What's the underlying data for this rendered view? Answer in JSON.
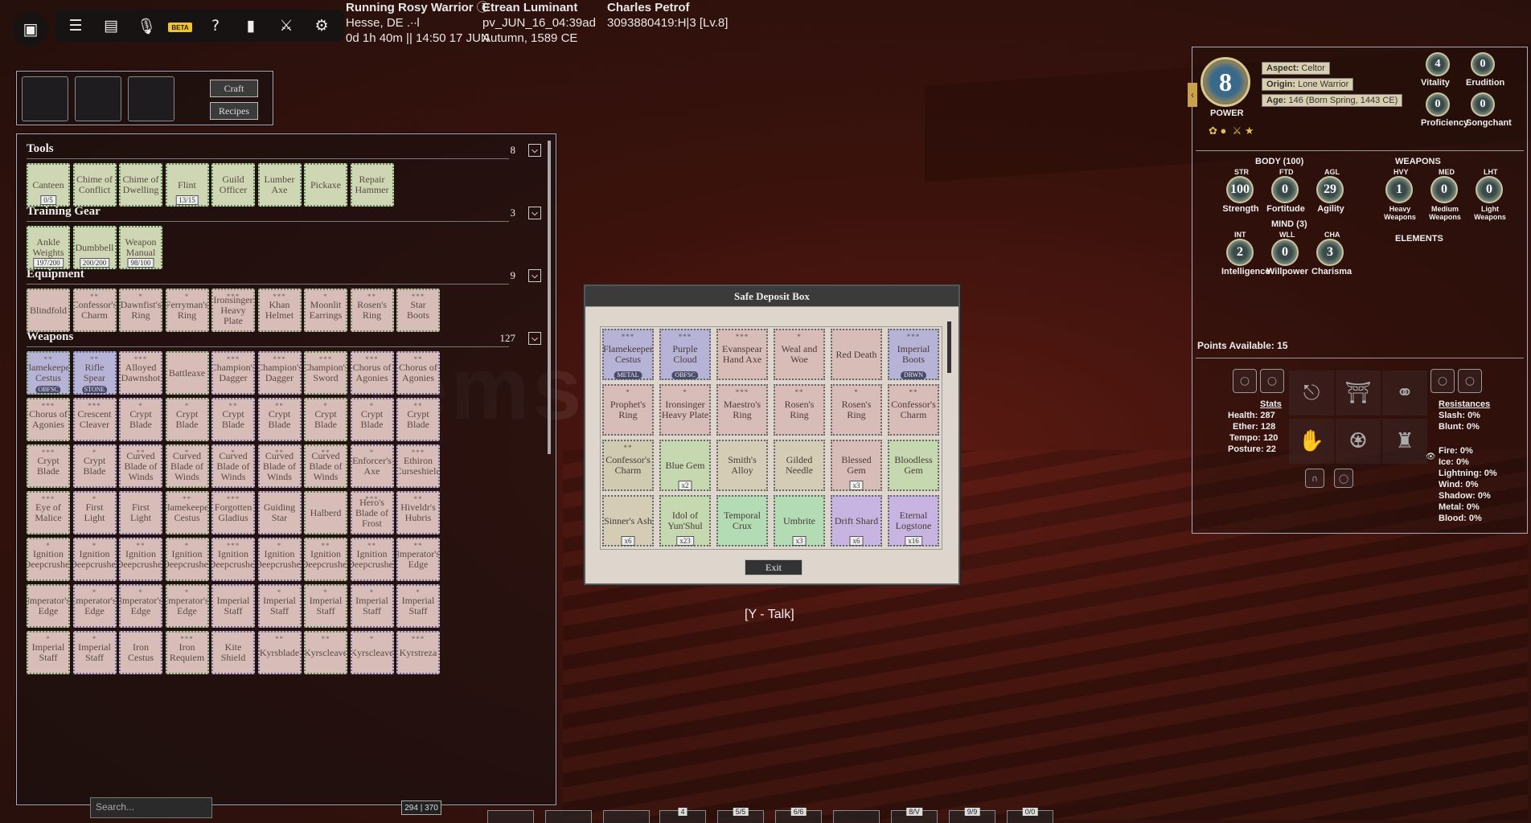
{
  "topbar": {
    "beta": "BETA",
    "server": {
      "name": "Running Rosy Warrior",
      "region": "Hesse, DE .∙∙l",
      "uptime": "0d 1h 40m || 14:50 17 JUN"
    },
    "realm": {
      "name": "Etrean Luminant",
      "id": "pv_JUN_16_04:39ad",
      "date": "Autumn, 1589 CE"
    },
    "player": {
      "name": "Charles Petrof",
      "id": "3093880419:H|3 [Lv.8]"
    }
  },
  "craft": {
    "craft_label": "Craft",
    "recipes_label": "Recipes"
  },
  "inventory": {
    "sections": [
      {
        "title": "Tools",
        "count": "8",
        "items": [
          {
            "name": "Canteen",
            "qty": "0/5"
          },
          {
            "name": "Chime of Conflict"
          },
          {
            "name": "Chime of Dwelling"
          },
          {
            "name": "Flint",
            "qty": "13/15"
          },
          {
            "name": "Guild Officer"
          },
          {
            "name": "Lumber Axe"
          },
          {
            "name": "Pickaxe"
          },
          {
            "name": "Repair Hammer"
          }
        ]
      },
      {
        "title": "Training Gear",
        "count": "3",
        "items": [
          {
            "name": "Ankle Weights",
            "qty": "197/200"
          },
          {
            "name": "Dumbbell",
            "qty": "200/200"
          },
          {
            "name": "Weapon Manual",
            "qty": "98/100"
          }
        ]
      },
      {
        "title": "Equipment",
        "count": "9",
        "items": [
          {
            "name": "Blindfold"
          },
          {
            "name": "Confessor's Charm",
            "stars": "**"
          },
          {
            "name": "Dawnfist's Ring",
            "stars": "*"
          },
          {
            "name": "Ferryman's Ring",
            "stars": "*"
          },
          {
            "name": "Ironsinger Heavy Plate",
            "stars": "***"
          },
          {
            "name": "Khan Helmet",
            "stars": "***"
          },
          {
            "name": "Moonlit Earrings",
            "stars": "*"
          },
          {
            "name": "Rosen's Ring",
            "stars": "**"
          },
          {
            "name": "Star Boots",
            "stars": "***"
          }
        ]
      },
      {
        "title": "Weapons",
        "count": "127",
        "items": [
          {
            "name": "Flamekeeper Cestus",
            "stars": "**",
            "tag": "OBFSC"
          },
          {
            "name": "Rifle Spear",
            "stars": "**",
            "tag": "STONE"
          },
          {
            "name": "Alloyed Dawnshot",
            "stars": "***"
          },
          {
            "name": "Battleaxe"
          },
          {
            "name": "Champion's Dagger",
            "stars": "***"
          },
          {
            "name": "Champion's Dagger",
            "stars": "***"
          },
          {
            "name": "Champion's Sword",
            "stars": "***"
          },
          {
            "name": "Chorus of Agonies",
            "stars": "***"
          },
          {
            "name": "Chorus of Agonies",
            "stars": "**"
          },
          {
            "name": "Chorus of Agonies",
            "stars": "***"
          },
          {
            "name": "Crescent Cleaver",
            "stars": "***"
          },
          {
            "name": "Crypt Blade",
            "stars": "*"
          },
          {
            "name": "Crypt Blade",
            "stars": "*"
          },
          {
            "name": "Crypt Blade",
            "stars": "**"
          },
          {
            "name": "Crypt Blade",
            "stars": "**"
          },
          {
            "name": "Crypt Blade",
            "stars": "*"
          },
          {
            "name": "Crypt Blade",
            "stars": "*"
          },
          {
            "name": "Crypt Blade",
            "stars": "**"
          },
          {
            "name": "Crypt Blade",
            "stars": "***"
          },
          {
            "name": "Crypt Blade",
            "stars": "*"
          },
          {
            "name": "Curved Blade of Winds",
            "stars": "**"
          },
          {
            "name": "Curved Blade of Winds",
            "stars": "*"
          },
          {
            "name": "Curved Blade of Winds",
            "stars": "*"
          },
          {
            "name": "Curved Blade of Winds",
            "stars": "**"
          },
          {
            "name": "Curved Blade of Winds",
            "stars": "**"
          },
          {
            "name": "Enforcer's Axe",
            "stars": "*"
          },
          {
            "name": "Ethiron Curseshield",
            "stars": "***"
          },
          {
            "name": "Eye of Malice",
            "stars": "***"
          },
          {
            "name": "First Light",
            "stars": "*"
          },
          {
            "name": "First Light"
          },
          {
            "name": "Flamekeeper Cestus",
            "stars": "**"
          },
          {
            "name": "Forgotten Gladius",
            "stars": "***"
          },
          {
            "name": "Guiding Star"
          },
          {
            "name": "Halberd"
          },
          {
            "name": "Hero's Blade of Frost",
            "stars": "***"
          },
          {
            "name": "Hiveldr's Hubris",
            "stars": "**"
          },
          {
            "name": "Ignition Deepcrusher",
            "stars": "*"
          },
          {
            "name": "Ignition Deepcrusher",
            "stars": "*"
          },
          {
            "name": "Ignition Deepcrusher",
            "stars": "**"
          },
          {
            "name": "Ignition Deepcrusher",
            "stars": "*"
          },
          {
            "name": "Ignition Deepcrusher",
            "stars": "***"
          },
          {
            "name": "Ignition Deepcrusher",
            "stars": "*"
          },
          {
            "name": "Ignition Deepcrusher",
            "stars": "**"
          },
          {
            "name": "Ignition Deepcrusher",
            "stars": "**"
          },
          {
            "name": "Imperator's Edge",
            "stars": "**"
          },
          {
            "name": "Imperator's Edge"
          },
          {
            "name": "Imperator's Edge",
            "stars": "*"
          },
          {
            "name": "Imperator's Edge",
            "stars": "*"
          },
          {
            "name": "Imperator's Edge",
            "stars": "*"
          },
          {
            "name": "Imperial Staff"
          },
          {
            "name": "Imperial Staff",
            "stars": "*"
          },
          {
            "name": "Imperial Staff",
            "stars": "*"
          },
          {
            "name": "Imperial Staff",
            "stars": "*"
          },
          {
            "name": "Imperial Staff",
            "stars": "*"
          },
          {
            "name": "Imperial Staff",
            "stars": "*"
          },
          {
            "name": "Imperial Staff",
            "stars": "*"
          },
          {
            "name": "Iron Cestus"
          },
          {
            "name": "Iron Requiem",
            "stars": "***"
          },
          {
            "name": "Kite Shield"
          },
          {
            "name": "Kyrsblade",
            "stars": "**"
          },
          {
            "name": "Kyrscleave",
            "stars": "**"
          },
          {
            "name": "Kyrscleave",
            "stars": "*"
          },
          {
            "name": "Kyrstreza",
            "stars": "***"
          }
        ]
      }
    ],
    "search_placeholder": "Search...",
    "capacity": "294 | 370"
  },
  "deposit": {
    "title": "Safe Deposit Box",
    "exit_label": "Exit",
    "items": [
      {
        "name": "Flamekeeper Cestus",
        "stars": "***",
        "tag": "METAL",
        "color": "#b6b3d6"
      },
      {
        "name": "Purple Cloud",
        "stars": "***",
        "tag": "OBFSC",
        "color": "#b6b3d6"
      },
      {
        "name": "Evanspear Hand Axe",
        "stars": "***",
        "color": "#d8bcb8"
      },
      {
        "name": "Weal and Woe",
        "stars": "*",
        "color": "#d8bcb8"
      },
      {
        "name": "Red Death",
        "color": "#d8bcb8"
      },
      {
        "name": "Imperial Boots",
        "stars": "***",
        "tag": "DRWN",
        "color": "#b6b3d6"
      },
      {
        "name": "Prophet's Ring",
        "stars": "*",
        "color": "#d8bcb8"
      },
      {
        "name": "Ironsinger Heavy Plate",
        "stars": "*",
        "color": "#d8bcb8"
      },
      {
        "name": "Maestro's Ring",
        "stars": "***",
        "color": "#d8bcb8"
      },
      {
        "name": "Rosen's Ring",
        "stars": "**",
        "color": "#d8bcb8"
      },
      {
        "name": "Rosen's Ring",
        "stars": "*",
        "color": "#d8bcb8"
      },
      {
        "name": "Confessor's Charm",
        "stars": "**",
        "color": "#d8bcb8"
      },
      {
        "name": "Confessor's Charm",
        "stars": "**",
        "color": "#cfcab0"
      },
      {
        "name": "Blue Gem",
        "qty": "x2",
        "color": "#c6d8b0"
      },
      {
        "name": "Smith's Alloy",
        "color": "#d4ccb4"
      },
      {
        "name": "Gilded Needle",
        "color": "#d4ccb4"
      },
      {
        "name": "Blessed Gem",
        "qty": "x3",
        "color": "#d8bcb8"
      },
      {
        "name": "Bloodless Gem",
        "color": "#c6d8b0"
      },
      {
        "name": "Sinner's Ash",
        "qty": "x6",
        "color": "#d4ccb4"
      },
      {
        "name": "Idol of Yun'Shul",
        "qty": "x23",
        "color": "#c6d8b0"
      },
      {
        "name": "Temporal Crux",
        "color": "#b4dcb4"
      },
      {
        "name": "Umbrite",
        "qty": "x3",
        "color": "#b4dcb4"
      },
      {
        "name": "Drift Shard",
        "qty": "x6",
        "color": "#c8b4e0"
      },
      {
        "name": "Eternal Logstone",
        "qty": "x16",
        "color": "#c8b4e0"
      }
    ]
  },
  "talk_prompt": "[Y - Talk]",
  "character": {
    "power": "8",
    "power_label": "POWER",
    "aspect_label": "Aspect:",
    "aspect": "Celtor",
    "origin_label": "Origin:",
    "origin": "Lone Warrior",
    "age_label": "Age:",
    "age": "146 (Born Spring, 1443 CE)",
    "side_stats": [
      {
        "label": "Vitality",
        "value": "4"
      },
      {
        "label": "Erudition",
        "value": "0"
      },
      {
        "label": "Proficiency",
        "value": "0"
      },
      {
        "label": "Songchant",
        "value": "0"
      }
    ],
    "body_label": "BODY (100)",
    "weapons_label": "WEAPONS",
    "mind_label": "MIND (3)",
    "elements_label": "ELEMENTS",
    "body": [
      {
        "abbr": "STR",
        "value": "100",
        "label": "Strength"
      },
      {
        "abbr": "FTD",
        "value": "0",
        "label": "Fortitude"
      },
      {
        "abbr": "AGL",
        "value": "29",
        "label": "Agility"
      }
    ],
    "weapons": [
      {
        "abbr": "HVY",
        "value": "1",
        "label": "Heavy Weapons"
      },
      {
        "abbr": "MED",
        "value": "0",
        "label": "Medium Weapons"
      },
      {
        "abbr": "LHT",
        "value": "0",
        "label": "Light Weapons"
      }
    ],
    "mind": [
      {
        "abbr": "INT",
        "value": "2",
        "label": "Intelligence"
      },
      {
        "abbr": "WLL",
        "value": "0",
        "label": "Willpower"
      },
      {
        "abbr": "CHA",
        "value": "3",
        "label": "Charisma"
      }
    ],
    "points_label": "Points Available:",
    "points": "15",
    "stats_label": "Stats",
    "health": "Health: 287",
    "ether": "Ether: 128",
    "tempo": "Tempo: 120",
    "posture": "Posture: 22",
    "resist_label": "Resistances",
    "resist": [
      "Slash: 0%",
      "Blunt: 0%"
    ],
    "elem_resist": [
      "Fire: 0%",
      "Ice: 0%",
      "Lightning: 0%",
      "Wind: 0%",
      "Shadow: 0%",
      "Metal: 0%",
      "Blood: 0%"
    ]
  },
  "hotbar": [
    "4",
    "5/5",
    "6/6",
    "",
    "8/V",
    "9/9",
    "0/0"
  ],
  "colors": {
    "tool": "#cfd6b4",
    "equip": "#d8bcb8",
    "weapon_pink": "#d8bcb8",
    "weapon_purple": "#b6b3d6"
  }
}
